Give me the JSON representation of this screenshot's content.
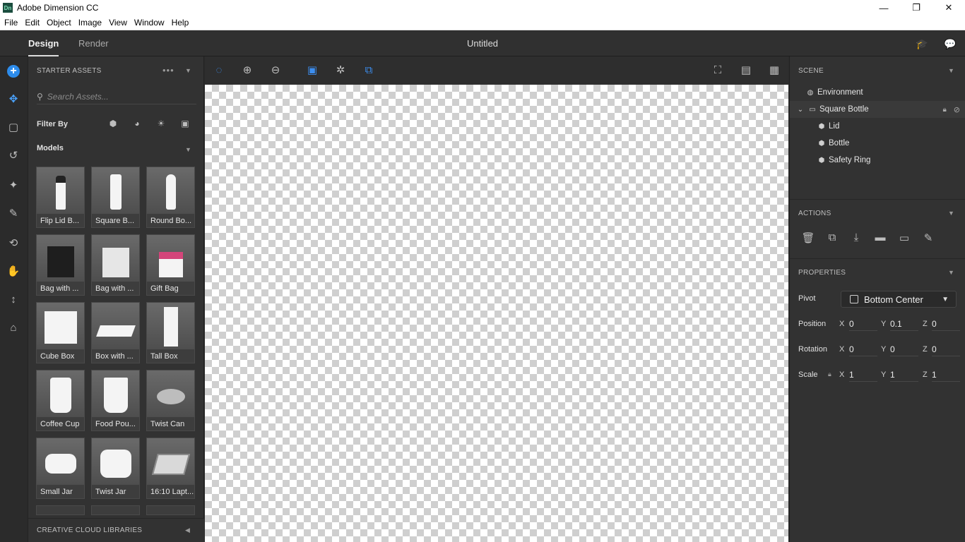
{
  "window": {
    "title": "Adobe Dimension CC",
    "icon_text": "Dn",
    "controls": [
      "—",
      "❐",
      "✕"
    ]
  },
  "menu": [
    "File",
    "Edit",
    "Object",
    "Image",
    "View",
    "Window",
    "Help"
  ],
  "top": {
    "tabs": [
      "Design",
      "Render"
    ],
    "doc_title": "Untitled"
  },
  "assets": {
    "header": "STARTER ASSETS",
    "search_placeholder": "Search Assets...",
    "filter_label": "Filter By",
    "models_label": "Models",
    "models": [
      "Flip Lid B...",
      "Square B...",
      "Round Bo...",
      "Bag with ...",
      "Bag with ...",
      "Gift Bag",
      "Cube Box",
      "Box with ...",
      "Tall Box",
      "Coffee Cup",
      "Food Pou...",
      "Twist Can",
      "Small Jar",
      "Twist Jar",
      "16:10 Lapt..."
    ],
    "libraries_header": "CREATIVE CLOUD LIBRARIES"
  },
  "scene": {
    "header": "SCENE",
    "items": [
      {
        "label": "Environment",
        "level": 0
      },
      {
        "label": "Square Bottle",
        "level": 0
      },
      {
        "label": "Lid",
        "level": 1
      },
      {
        "label": "Bottle",
        "level": 1
      },
      {
        "label": "Safety Ring",
        "level": 1
      }
    ]
  },
  "actions": {
    "header": "ACTIONS"
  },
  "properties": {
    "header": "PROPERTIES",
    "pivot_label": "Pivot",
    "pivot_value": "Bottom Center",
    "position_label": "Position",
    "rotation_label": "Rotation",
    "scale_label": "Scale",
    "axes": [
      "X",
      "Y",
      "Z"
    ],
    "position": [
      "0",
      "0.1",
      "0"
    ],
    "rotation": [
      "0",
      "0",
      "0"
    ],
    "scale": [
      "1",
      "1",
      "1"
    ]
  },
  "colors": {
    "accent": "#2d8ceb",
    "panel": "#323232",
    "toolbar": "#303030"
  }
}
